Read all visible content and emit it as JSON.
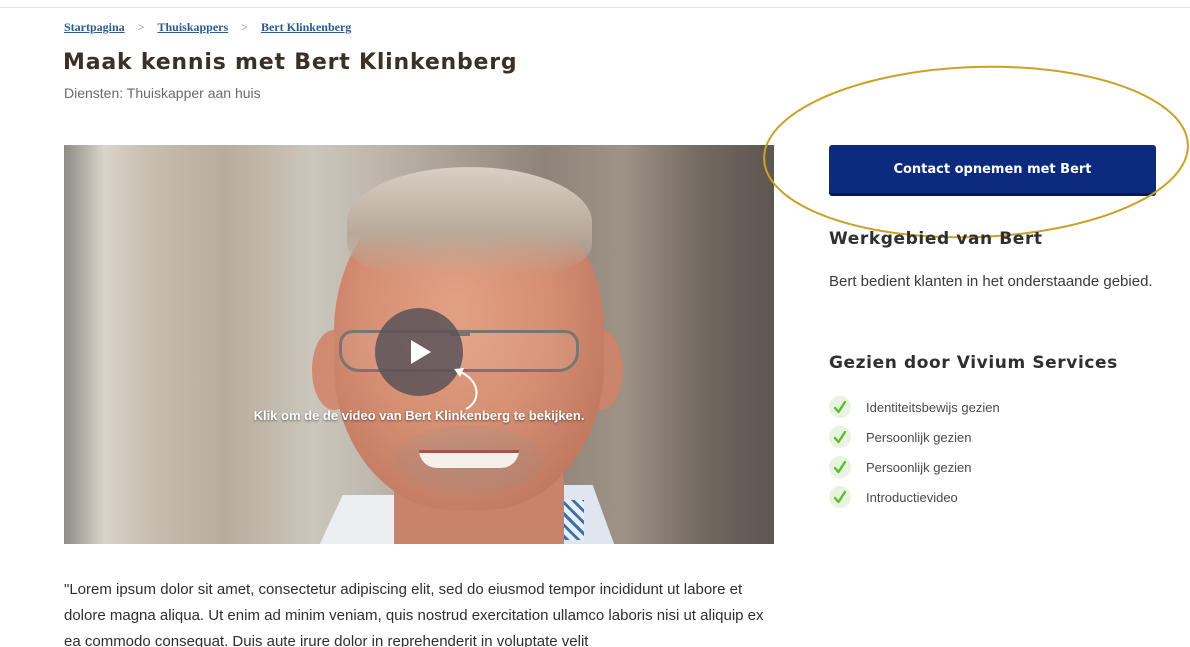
{
  "breadcrumb": {
    "items": [
      "Startpagina",
      "Thuiskappers",
      "Bert Klinkenberg"
    ],
    "separator": ">"
  },
  "page": {
    "title": "Maak kennis met Bert Klinkenberg",
    "services": "Diensten: Thuiskapper aan huis"
  },
  "video": {
    "caption": "Klik om de de video van Bert Klinkenberg te bekijken.",
    "play_icon": "play-icon"
  },
  "bio": {
    "text": "\"Lorem ipsum dolor sit amet, consectetur adipiscing elit, sed do eiusmod tempor incididunt ut labore et dolore magna aliqua. Ut enim ad minim veniam, quis nostrud exercitation ullamco laboris nisi ut aliquip ex ea commodo consequat. Duis aute irure dolor in reprehenderit in voluptate velit"
  },
  "sidebar": {
    "contact_button": "Contact opnemen met Bert",
    "area_title": "Werkgebied van Bert",
    "area_text": "Bert bedient klanten in het onderstaande gebied.",
    "verified_title": "Gezien door Vivium Services",
    "verified_items": [
      "Identiteitsbewijs gezien",
      "Persoonlijk gezien",
      "Persoonlijk gezien",
      "Introductievideo"
    ]
  },
  "colors": {
    "button_bg": "#0d2b7e",
    "check_green": "#5bbf2a",
    "annotation_gold": "#c9a227",
    "link": "#2a5c8f"
  }
}
